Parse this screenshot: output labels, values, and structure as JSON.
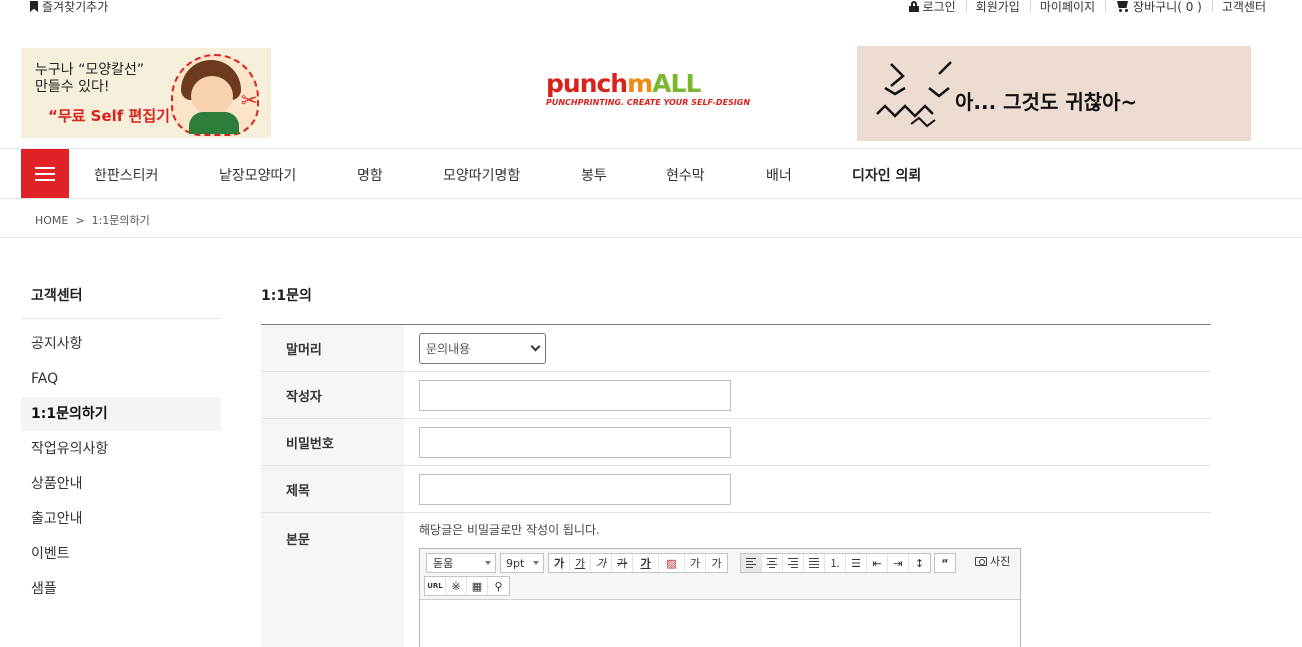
{
  "topbar": {
    "favorite": "즐겨찾기추가",
    "login": "로그인",
    "join": "회원가입",
    "mypage": "마이페이지",
    "cart": "장바구니( 0 )",
    "customer_center": "고객센터"
  },
  "banner_left": {
    "line1": "누구나 “모양칼선”",
    "line2": "만들수 있다!",
    "line3": "“무료 Self 편집기”"
  },
  "logo": {
    "word1": "punch",
    "word2": "m",
    "word3": "ALL",
    "tagline": "PUNCHPRINTING. CREATE YOUR SELF-DESIGN"
  },
  "banner_right": {
    "text": "아... 그것도 귀찮아~"
  },
  "nav": {
    "items": [
      "한판스티커",
      "낱장모양따기",
      "명함",
      "모양따기명함",
      "봉투",
      "현수막",
      "배너",
      "디자인 의뢰"
    ]
  },
  "breadcrumb": "HOME  >  1:1문의하기",
  "sidebar": {
    "title": "고객센터",
    "items": [
      "공지사항",
      "FAQ",
      "1:1문의하기",
      "작업유의사항",
      "상품안내",
      "출고안내",
      "이벤트",
      "샘플"
    ],
    "active_index": 2
  },
  "content": {
    "title": "1:1문의",
    "fields": {
      "header_label": "말머리",
      "header_select": "문의내용",
      "author_label": "작성자",
      "author_value": "",
      "password_label": "비밀번호",
      "password_value": "",
      "subject_label": "제목",
      "subject_value": "",
      "body_label": "본문",
      "body_notice": "해당글은 비밀글로만 작성이 됩니다."
    }
  },
  "editor": {
    "font": "돋움",
    "size": "9pt",
    "bold": "가",
    "underline": "가",
    "italic": "가",
    "strike": "가",
    "font_color": "가",
    "superscript": "가",
    "subscript": "가",
    "quote": "“",
    "photo": "사진",
    "url": "URL"
  },
  "colors": {
    "accent": "#e12128",
    "logo_orange": "#f08a12",
    "logo_green": "#7cb82f"
  }
}
